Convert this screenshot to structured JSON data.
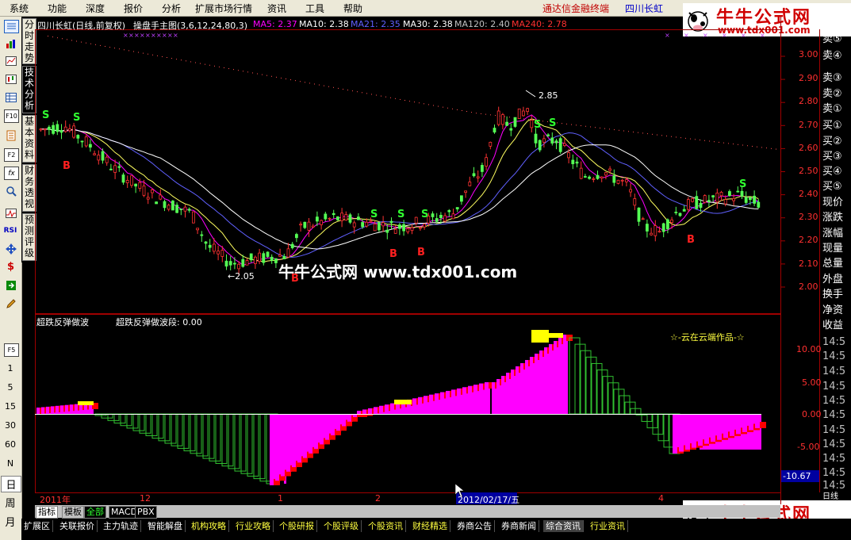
{
  "menu": {
    "items": [
      "系统",
      "功能",
      "深度",
      "报价",
      "分析",
      "扩展市场行情",
      "资讯",
      "工具",
      "帮助"
    ],
    "brand": "通达信金融终端",
    "stock": "四川长虹"
  },
  "logo": {
    "title": "牛牛公式网",
    "url": "www.tdx001.com"
  },
  "left_tabs": [
    "分时走势",
    "技术分析",
    "基本资料",
    "财务透视",
    "预测评级"
  ],
  "toolbar": {
    "icons": [
      "quote-list-icon",
      "bar-chart-icon",
      "line-chart-icon",
      "candle-chart-icon",
      "table-icon",
      "f10-icon",
      "doc-icon",
      "f2-icon",
      "fx-icon",
      "search-icon",
      "pulse-icon",
      "rsi-icon",
      "move-icon",
      "dollar-icon",
      "export-icon",
      "pencil-icon",
      "f5-icon"
    ],
    "labels": {
      "f10": "F10",
      "f2": "F2",
      "fx": "fx",
      "rsi": "RSI",
      "f5": "F5"
    },
    "periods": [
      "1",
      "5",
      "15",
      "30",
      "60",
      "N",
      "日",
      "周",
      "月"
    ]
  },
  "main_chart": {
    "title": "四川长虹(日线,前复权)",
    "indicator_name": "操盘手主图(3,6,12,24,80,3)",
    "ma": [
      {
        "label": "MA5: 2.37",
        "color": "#ff00ff"
      },
      {
        "label": "MA10: 2.38",
        "color": "#ffffff"
      },
      {
        "label": "MA21: 2.35",
        "color": "#6060ff"
      },
      {
        "label": "MA30: 2.38",
        "color": "#ffffff"
      },
      {
        "label": "MA120: 2.40",
        "color": "#c0c0c0"
      },
      {
        "label": "MA240: 2.78",
        "color": "#ff3030"
      }
    ],
    "high_label": "2.85",
    "low_label": "←2.05",
    "watermark": "牛牛公式网 www.tdx001.com",
    "signals_S": [
      "S",
      "S",
      "S",
      "S",
      "S",
      "S",
      "S",
      "S"
    ],
    "signals_B": [
      "B",
      "B",
      "B",
      "B",
      "B",
      "B"
    ],
    "price_axis": [
      "3.00",
      "2.90",
      "2.80",
      "2.70",
      "2.60",
      "2.50",
      "2.40",
      "2.30",
      "2.20",
      "2.10",
      "2.00"
    ]
  },
  "sub_chart": {
    "name": "超跌反弹做波",
    "value_label": "超跌反弹做波段: 0.00",
    "credit": "☆-云在云端作品-☆",
    "axis": [
      "10.00",
      "5.00",
      "0.00",
      "-5.00"
    ],
    "current_value": "-10.67"
  },
  "date_axis": {
    "labels": [
      "2011年",
      "12",
      "1",
      "2",
      "4"
    ],
    "cursor_date": "2012/02/17/五"
  },
  "right_panel": {
    "labels": [
      "卖⑤",
      "卖④",
      "卖③",
      "卖②",
      "卖①",
      "买①",
      "买②",
      "买③",
      "买④",
      "买⑤",
      "现价",
      "涨跌",
      "涨幅",
      "现量",
      "总量",
      "外盘",
      "换手",
      "净资",
      "收益"
    ],
    "time_labels": [
      "14:5",
      "14:5",
      "14:5",
      "14:5",
      "14:5",
      "14:5",
      "14:5",
      "14:5",
      "14:5",
      "14:5",
      "14:5"
    ],
    "bottom_label": "日线"
  },
  "bottom_tabs": [
    "指标",
    "模板",
    "全部",
    "MACD",
    "PBX"
  ],
  "bottom_bar": [
    "扩展区",
    "关联报价",
    "主力轨迹",
    "智能解盘",
    "机构攻略",
    "行业攻略",
    "个股研报",
    "个股评级",
    "个股资讯",
    "财经精选",
    "券商公告",
    "券商新闻",
    "综合资讯",
    "行业资讯"
  ],
  "colors": {
    "up": "#ff3232",
    "down": "#54ff54",
    "ma5": "#ff00ff",
    "ma10": "#ffff60",
    "ma21": "#6060ff",
    "ma30": "#ffffff",
    "magenta": "#ff00ff",
    "brand": "#c00000"
  }
}
